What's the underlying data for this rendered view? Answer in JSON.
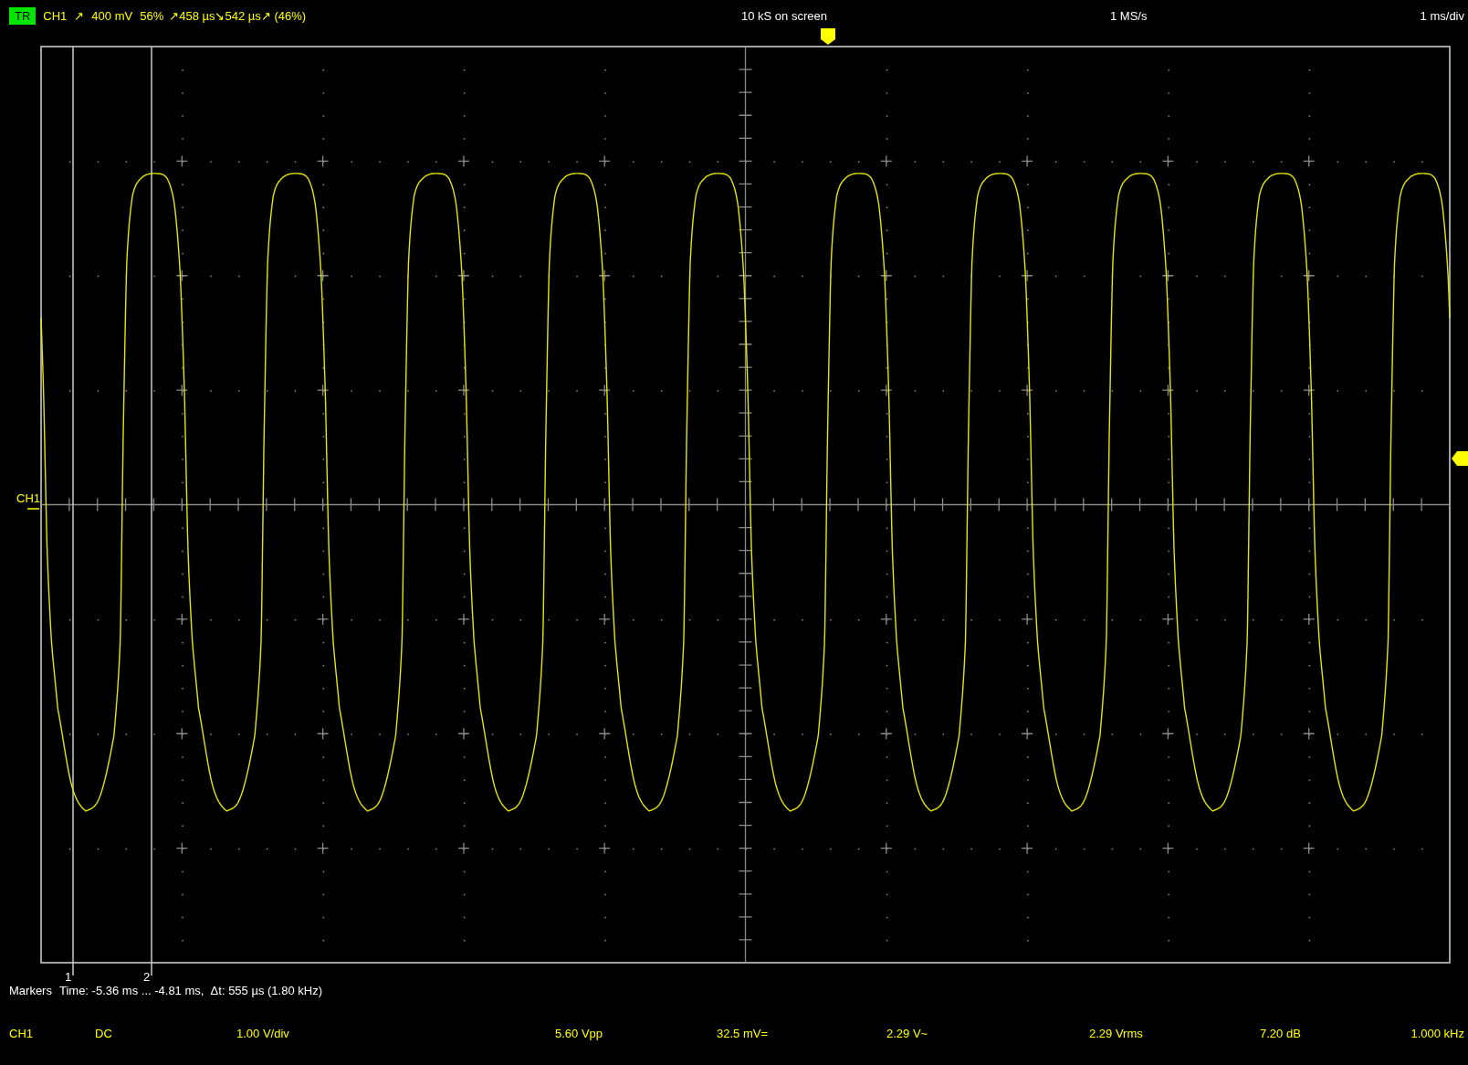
{
  "header": {
    "trigger_badge": "TR",
    "trigger_channel": "CH1",
    "trigger_slope": "↗",
    "trigger_level": "400 mV",
    "trigger_percent": "56%",
    "timing": "↗458 µs↘542 µs↗ (46%)",
    "samples_on_screen": "10 kS on screen",
    "sample_rate": "1 MS/s",
    "timebase": "1 ms/div"
  },
  "plot": {
    "channel_label": "CH1",
    "marker_labels": [
      "1",
      "2"
    ]
  },
  "markers_readout": {
    "label": "Markers",
    "text": "Time: -5.36 ms ... -4.81 ms,  Δt: 555 µs (1.80 kHz)"
  },
  "channel_bar": [
    "CH1",
    "DC",
    "1.00 V/div",
    "5.60 Vpp",
    "32.5 mV=",
    "2.29 V~",
    "2.29 Vrms",
    "7.20 dB",
    "1.000 kHz"
  ]
}
